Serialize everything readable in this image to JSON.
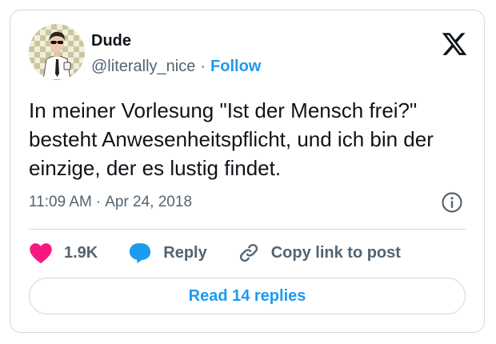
{
  "author": {
    "display_name": "Dude",
    "handle": "@literally_nice",
    "separator": "·",
    "follow_label": "Follow"
  },
  "tweet": {
    "text": "In meiner Vorlesung \"Ist der Mensch frei?\" besteht Anwesenheitspflicht, und ich bin der einzige, der es lustig findet.",
    "time": "11:09 AM",
    "separator": "·",
    "date": "Apr 24, 2018"
  },
  "actions": {
    "like_count": "1.9K",
    "reply_label": "Reply",
    "copy_link_label": "Copy link to post"
  },
  "read_replies_label": "Read 14 replies",
  "icons": {
    "platform": "x-logo-icon",
    "info": "info-icon",
    "like": "heart-icon",
    "reply": "speech-bubble-icon",
    "copy": "link-icon"
  },
  "colors": {
    "accent": "#1d9bf0",
    "like": "#f91880",
    "secondary_text": "#536471",
    "border": "#cfd9de"
  }
}
